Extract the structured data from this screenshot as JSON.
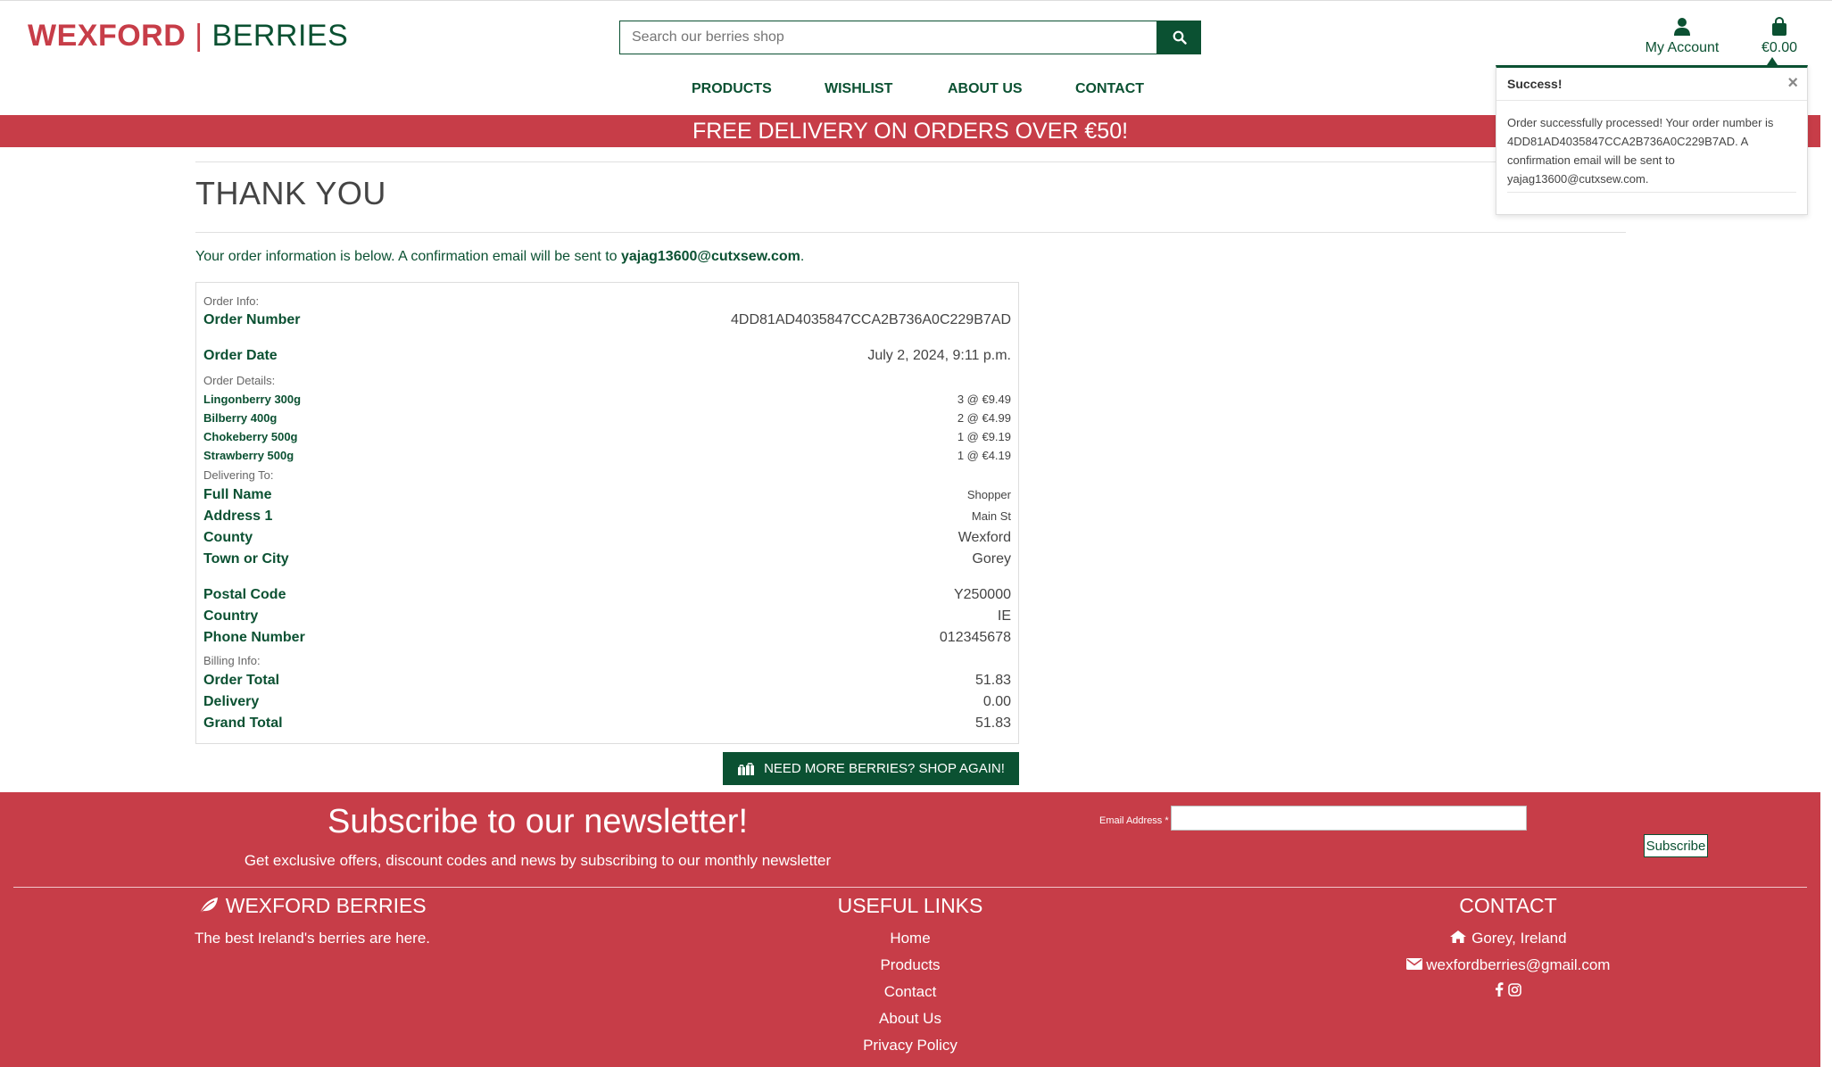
{
  "header": {
    "logo_part1": "WEXFORD",
    "logo_sep": " | ",
    "logo_part2": "BERRIES",
    "search_placeholder": "Search our berries shop",
    "account_label": "My Account",
    "bag_total": "€0.00"
  },
  "nav": [
    "PRODUCTS",
    "WISHLIST",
    "ABOUT US",
    "CONTACT"
  ],
  "banner": "FREE DELIVERY ON ORDERS OVER €50!",
  "page": {
    "title": "THANK YOU",
    "intro_text": "Your order information is below. A confirmation email will be sent to ",
    "intro_email": "yajag13600@cutxsew.com",
    "intro_end": "."
  },
  "order": {
    "order_info_label": "Order Info:",
    "order_number_label": "Order Number",
    "order_number": "4DD81AD4035847CCA2B736A0C229B7AD",
    "order_date_label": "Order Date",
    "order_date": "July 2, 2024, 9:11 p.m.",
    "order_details_label": "Order Details:",
    "items": [
      {
        "name": "Lingonberry 300g",
        "qty": "3 @ €9.49"
      },
      {
        "name": "Bilberry 400g",
        "qty": "2 @ €4.99"
      },
      {
        "name": "Chokeberry 500g",
        "qty": "1 @ €9.19"
      },
      {
        "name": "Strawberry 500g",
        "qty": "1 @ €4.19"
      }
    ],
    "delivering_label": "Delivering To:",
    "full_name_label": "Full Name",
    "full_name": "Shopper",
    "address1_label": "Address 1",
    "address1": "Main St",
    "county_label": "County",
    "county": "Wexford",
    "town_label": "Town or City",
    "town": "Gorey",
    "postal_label": "Postal Code",
    "postal": "Y250000",
    "country_label": "Country",
    "country": "IE",
    "phone_label": "Phone Number",
    "phone": "012345678",
    "billing_label": "Billing Info:",
    "order_total_label": "Order Total",
    "order_total": "51.83",
    "delivery_label": "Delivery",
    "delivery": "0.00",
    "grand_total_label": "Grand Total",
    "grand_total": "51.83"
  },
  "shop_again_label": "NEED MORE BERRIES? SHOP AGAIN!",
  "toast": {
    "title": "Success!",
    "close": "×",
    "message": "Order successfully processed! Your order number is 4DD81AD4035847CCA2B736A0C229B7AD. A confirmation email will be sent to yajag13600@cutxsew.com."
  },
  "footer": {
    "newsletter_title": "Subscribe to our newsletter!",
    "newsletter_text": "Get exclusive offers, discount codes and news by subscribing to our monthly newsletter",
    "email_label": "Email Address *",
    "subscribe_label": "Subscribe",
    "brand_title": "WEXFORD BERRIES",
    "brand_tagline": "The best Ireland's berries are here.",
    "links_title": "USEFUL LINKS",
    "links": [
      "Home",
      "Products",
      "Contact",
      "About Us",
      "Privacy Policy"
    ],
    "contact_title": "CONTACT",
    "contact_location": "Gorey, Ireland",
    "contact_email": "wexfordberries@gmail.com"
  },
  "colors": {
    "brand_green": "#0b5132",
    "brand_red": "#c73d48"
  }
}
